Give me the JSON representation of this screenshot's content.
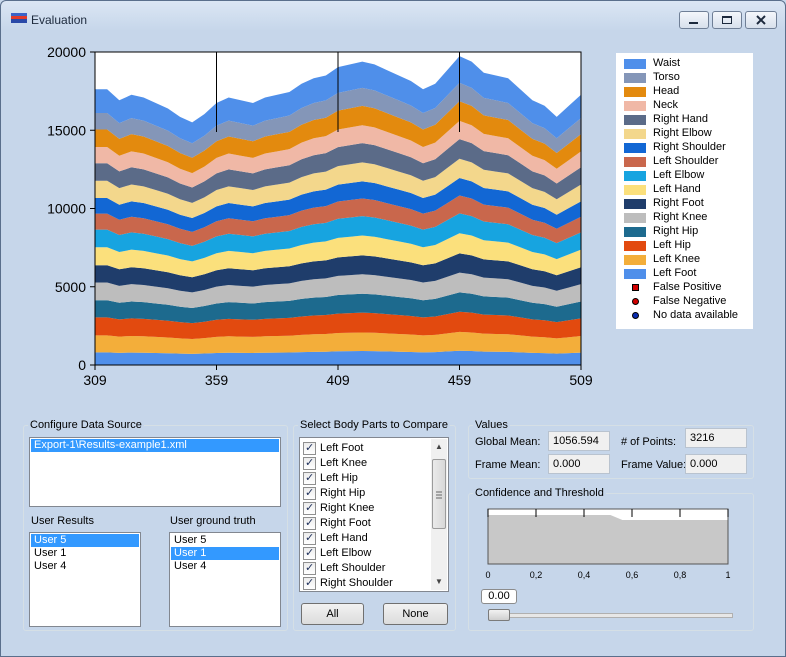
{
  "window": {
    "title": "Evaluation"
  },
  "colors": {
    "accent": "#3399ff"
  },
  "chart_data": {
    "type": "area",
    "x": [
      309,
      314,
      319,
      324,
      329,
      334,
      339,
      344,
      349,
      354,
      359,
      364,
      369,
      374,
      379,
      384,
      389,
      394,
      399,
      404,
      409,
      414,
      419,
      424,
      429,
      434,
      439,
      444,
      449,
      454,
      459,
      464,
      469,
      474,
      479,
      484,
      489,
      494,
      499,
      504,
      509
    ],
    "stacked": true,
    "xlim": [
      309,
      509
    ],
    "ylim": [
      0,
      20000
    ],
    "x_ticks": [
      "309",
      "359",
      "409",
      "459",
      "509"
    ],
    "y_ticks": [
      "0",
      "5000",
      "10000",
      "15000",
      "20000"
    ],
    "shape": [
      1.0,
      1.0,
      0.96,
      0.98,
      0.97,
      0.95,
      0.93,
      0.9,
      0.88,
      0.91,
      0.95,
      0.97,
      0.96,
      0.95,
      0.97,
      0.98,
      0.99,
      1.02,
      1.04,
      1.05,
      1.08,
      1.09,
      1.1,
      1.09,
      1.07,
      1.05,
      1.03,
      1.0,
      1.02,
      1.07,
      1.12,
      1.1,
      1.06,
      1.05,
      1.04,
      1.0,
      0.96,
      0.94,
      0.9,
      0.94,
      0.98
    ],
    "series": [
      {
        "name": "Left Foot",
        "color": "#4f8fea",
        "band": 810
      },
      {
        "name": "Left Knee",
        "color": "#f3ae3a",
        "band": 1080
      },
      {
        "name": "Left Hip",
        "color": "#e24a0f",
        "band": 1150
      },
      {
        "name": "Right Hip",
        "color": "#1d6a8e",
        "band": 1100
      },
      {
        "name": "Right Knee",
        "color": "#bdbdbd",
        "band": 1130
      },
      {
        "name": "Right Foot",
        "color": "#1f3d6b",
        "band": 1100
      },
      {
        "name": "Left Hand",
        "color": "#fbe07c",
        "band": 1150
      },
      {
        "name": "Left Elbow",
        "color": "#17a4e0",
        "band": 1130
      },
      {
        "name": "Left Shoulder",
        "color": "#c9674c",
        "band": 1020
      },
      {
        "name": "Right Shoulder",
        "color": "#1267d4",
        "band": 1000
      },
      {
        "name": "Right Elbow",
        "color": "#f3d78c",
        "band": 1100
      },
      {
        "name": "Right Hand",
        "color": "#5b6b88",
        "band": 1120
      },
      {
        "name": "Neck",
        "color": "#f0b8a6",
        "band": 1040
      },
      {
        "name": "Head",
        "color": "#e38a0e",
        "band": 1120
      },
      {
        "name": "Torso",
        "color": "#8496b8",
        "band": 1050
      },
      {
        "name": "Waist",
        "color": "#4f8fea",
        "band": 1520
      }
    ],
    "legend": [
      {
        "name": "Waist",
        "color": "#4f8fea",
        "marker": "swatch"
      },
      {
        "name": "Torso",
        "color": "#8496b8",
        "marker": "swatch"
      },
      {
        "name": "Head",
        "color": "#e38a0e",
        "marker": "swatch"
      },
      {
        "name": "Neck",
        "color": "#f0b8a6",
        "marker": "swatch"
      },
      {
        "name": "Right Hand",
        "color": "#5b6b88",
        "marker": "swatch"
      },
      {
        "name": "Right Elbow",
        "color": "#f3d78c",
        "marker": "swatch"
      },
      {
        "name": "Right Shoulder",
        "color": "#1267d4",
        "marker": "swatch"
      },
      {
        "name": "Left Shoulder",
        "color": "#c9674c",
        "marker": "swatch"
      },
      {
        "name": "Left Elbow",
        "color": "#17a4e0",
        "marker": "swatch"
      },
      {
        "name": "Left Hand",
        "color": "#fbe07c",
        "marker": "swatch"
      },
      {
        "name": "Right Foot",
        "color": "#1f3d6b",
        "marker": "swatch"
      },
      {
        "name": "Right Knee",
        "color": "#bdbdbd",
        "marker": "swatch"
      },
      {
        "name": "Right Hip",
        "color": "#1d6a8e",
        "marker": "swatch"
      },
      {
        "name": "Left Hip",
        "color": "#e24a0f",
        "marker": "swatch"
      },
      {
        "name": "Left Knee",
        "color": "#f3ae3a",
        "marker": "swatch"
      },
      {
        "name": "Left Foot",
        "color": "#4f8fea",
        "marker": "swatch"
      },
      {
        "name": "False Positive",
        "color": "#d00000",
        "marker": "square"
      },
      {
        "name": "False Negative",
        "color": "#d00000",
        "marker": "circle"
      },
      {
        "name": "No data available",
        "color": "#0a2cb0",
        "marker": "circle"
      }
    ]
  },
  "data_source": {
    "title": "Configure Data Source",
    "files": [
      "Export-1\\Results-example1.xml"
    ],
    "user_results_label": "User Results",
    "user_results": [
      "User 5",
      "User 1",
      "User 4"
    ],
    "ground_truth_label": "User ground truth",
    "ground_truth": [
      "User 5",
      "User 1",
      "User 4"
    ]
  },
  "body_parts": {
    "title": "Select Body Parts to Compare",
    "items": [
      "Left Foot",
      "Left Knee",
      "Left Hip",
      "Right Hip",
      "Right Knee",
      "Right Foot",
      "Left Hand",
      "Left Elbow",
      "Left Shoulder",
      "Right Shoulder"
    ],
    "check_mark": "✓",
    "all_label": "All",
    "none_label": "None"
  },
  "values": {
    "title": "Values",
    "global_mean_label": "Global Mean:",
    "global_mean": "1056.594",
    "points_label": "# of Points:",
    "points": "3216",
    "frame_mean_label": "Frame Mean:",
    "frame_mean": "0.000",
    "frame_value_label": "Frame Value:",
    "frame_value": "0.000"
  },
  "confidence": {
    "title": "Confidence and Threshold",
    "ticks": [
      "0",
      "0,2",
      "0,4",
      "0,6",
      "0,8",
      "1"
    ],
    "slider_value": "0.00",
    "slider_fraction": 0.0
  }
}
